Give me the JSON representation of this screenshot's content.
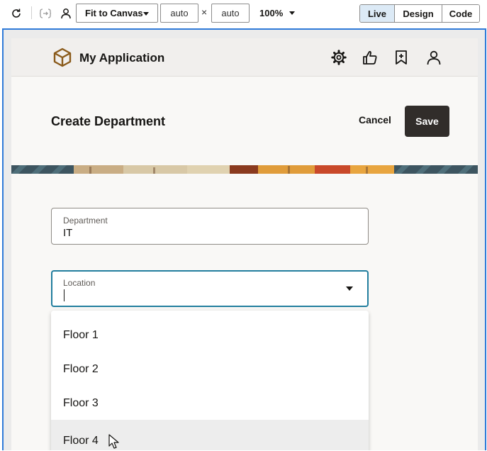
{
  "toolbar": {
    "refresh_icon": "refresh-icon",
    "binding_icon": "binding-icon",
    "user_icon": "user-icon",
    "fit_label": "Fit to Canvas",
    "width_value": "auto",
    "times_symbol": "×",
    "height_value": "auto",
    "zoom_label": "100%",
    "modes": [
      "Live",
      "Design",
      "Code"
    ],
    "active_mode": "Live"
  },
  "app": {
    "title": "My Application",
    "header_icons": [
      "gear-icon",
      "thumbs-up-icon",
      "bookmark-add-icon",
      "user-icon"
    ],
    "page_title": "Create Department",
    "cancel_label": "Cancel",
    "save_label": "Save",
    "department_field": {
      "label": "Department",
      "value": "IT"
    },
    "location_field": {
      "label": "Location",
      "value": ""
    },
    "location_options": [
      "Floor 1",
      "Floor 2",
      "Floor 3",
      "Floor 4"
    ],
    "hovered_option": "Floor 4"
  },
  "colors": {
    "accent_blue": "#2f7ad8",
    "focus_teal": "#227e9e",
    "save_button": "#312d2a",
    "logo_brown": "#8a5a1a"
  }
}
